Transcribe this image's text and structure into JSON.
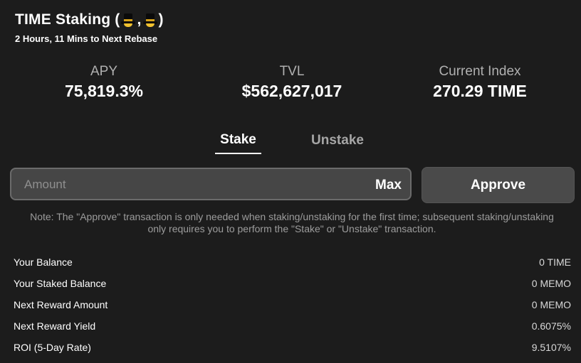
{
  "header": {
    "title_text": "TIME Staking (",
    "title_separator": ", ",
    "title_close": ")",
    "hat_icon": "top-hat-emoji-icon",
    "subtitle": "2 Hours, 11 Mins to Next Rebase"
  },
  "stats": {
    "apy": {
      "label": "APY",
      "value": "75,819.3%"
    },
    "tvl": {
      "label": "TVL",
      "value": "$562,627,017"
    },
    "index": {
      "label": "Current Index",
      "value": "270.29 TIME"
    }
  },
  "tabs": {
    "stake": "Stake",
    "unstake": "Unstake",
    "active": "stake"
  },
  "form": {
    "amount_placeholder": "Amount",
    "amount_value": "",
    "max_label": "Max",
    "approve_label": "Approve"
  },
  "note": "Note: The \"Approve\" transaction is only needed when staking/unstaking for the first time; subsequent staking/unstaking only requires you to perform the \"Stake\" or \"Unstake\" transaction.",
  "details": [
    {
      "label": "Your Balance",
      "value": "0 TIME"
    },
    {
      "label": "Your Staked Balance",
      "value": "0 MEMO"
    },
    {
      "label": "Next Reward Amount",
      "value": "0 MEMO"
    },
    {
      "label": "Next Reward Yield",
      "value": "0.6075%"
    },
    {
      "label": "ROI (5-Day Rate)",
      "value": "9.5107%"
    }
  ],
  "colors": {
    "background": "#1c1c1c",
    "input_background": "#464646",
    "button_background": "#4a4a4a",
    "muted_text": "#b0b0b0"
  }
}
